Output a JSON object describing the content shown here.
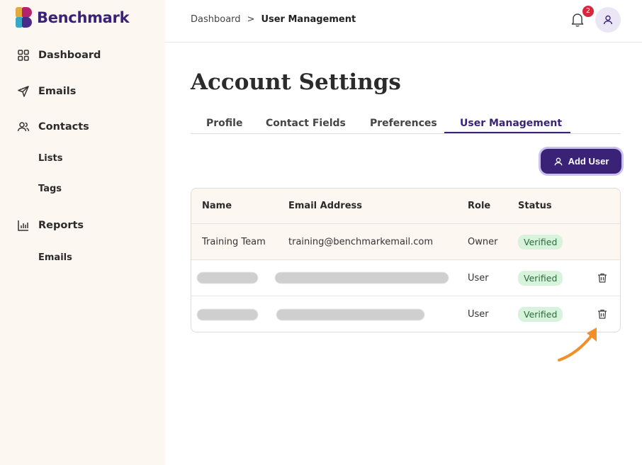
{
  "brand": {
    "name": "Benchmark"
  },
  "sidebar": {
    "items": [
      {
        "label": "Dashboard"
      },
      {
        "label": "Emails"
      },
      {
        "label": "Contacts"
      },
      {
        "label": "Lists"
      },
      {
        "label": "Tags"
      },
      {
        "label": "Reports"
      },
      {
        "label": "Emails"
      }
    ]
  },
  "header": {
    "breadcrumb": [
      "Dashboard",
      "User Management"
    ],
    "breadcrumb_separator": ">",
    "notification_count": "2"
  },
  "page": {
    "title": "Account Settings"
  },
  "tabs": [
    {
      "label": "Profile"
    },
    {
      "label": "Contact Fields"
    },
    {
      "label": "Preferences"
    },
    {
      "label": "User Management",
      "active": true
    }
  ],
  "actions": {
    "add_user_label": "Add User"
  },
  "table": {
    "columns": [
      "Name",
      "Email Address",
      "Role",
      "Status"
    ],
    "rows": [
      {
        "name": "Training Team",
        "email": "training@benchmarkemail.com",
        "role": "Owner",
        "status": "Verified"
      },
      {
        "name": "",
        "email": "",
        "role": "User",
        "status": "Verified"
      },
      {
        "name": "",
        "email": "",
        "role": "User",
        "status": "Verified"
      }
    ]
  },
  "colors": {
    "brand_purple": "#3a2377",
    "sidebar_bg": "#fdf7f1",
    "badge_red": "#d6283b",
    "verified_bg": "#d7f3dc",
    "arrow_orange": "#f0902a"
  }
}
